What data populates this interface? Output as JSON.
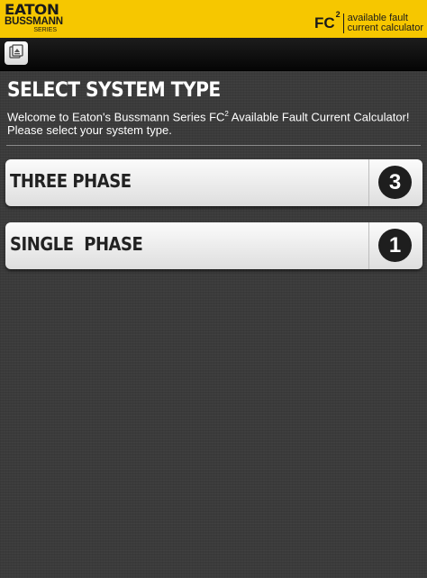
{
  "brand": {
    "logo_line1": "EATON",
    "logo_line2": "BUSSMANN",
    "logo_line3": "SERIES",
    "product_code": "FC",
    "product_superscript": "2",
    "product_desc_line1": "available fault",
    "product_desc_line2": "current calculator",
    "bar_color": "#f6c700"
  },
  "toolbar": {
    "icon": "notes-icon"
  },
  "page": {
    "title": "SELECT SYSTEM TYPE",
    "welcome_before": "Welcome to Eaton's Bussmann Series FC",
    "welcome_sup": "2",
    "welcome_after": " Available Fault Current Calculator! Please select your system type."
  },
  "options": [
    {
      "label": "THREE PHASE",
      "badge": "3"
    },
    {
      "label": "SINGLE  PHASE",
      "badge": "1"
    }
  ]
}
